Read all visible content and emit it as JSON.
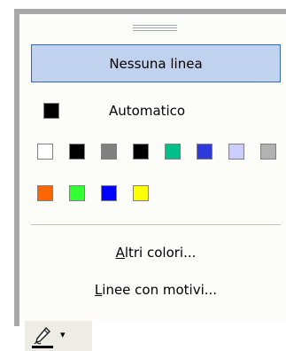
{
  "menu": {
    "none_label": "Nessuna linea",
    "automatic_label": "Automatico",
    "more_colors_label_accel": "A",
    "more_colors_label_rest": "ltri colori...",
    "patterned_lines_label_accel": "L",
    "patterned_lines_label_rest": "inee con motivi..."
  },
  "colors": {
    "automatic": "#000000",
    "row1": [
      "#ffffff",
      "#000000",
      "#808080",
      "#000000",
      "#00c08a",
      "#2f38d8",
      "#ccccff",
      "#b2b2b2"
    ],
    "row2": [
      "#ff6600",
      "#33ff33",
      "#0000ff",
      "#ffff00"
    ],
    "accent": "#316ac5",
    "hover_bg": "#c1d2ee"
  },
  "toolbar": {
    "line_color_icon": "pen-line-color-icon",
    "dropdown_icon": "chevron-down-icon",
    "dropdown_glyph": "▾"
  }
}
